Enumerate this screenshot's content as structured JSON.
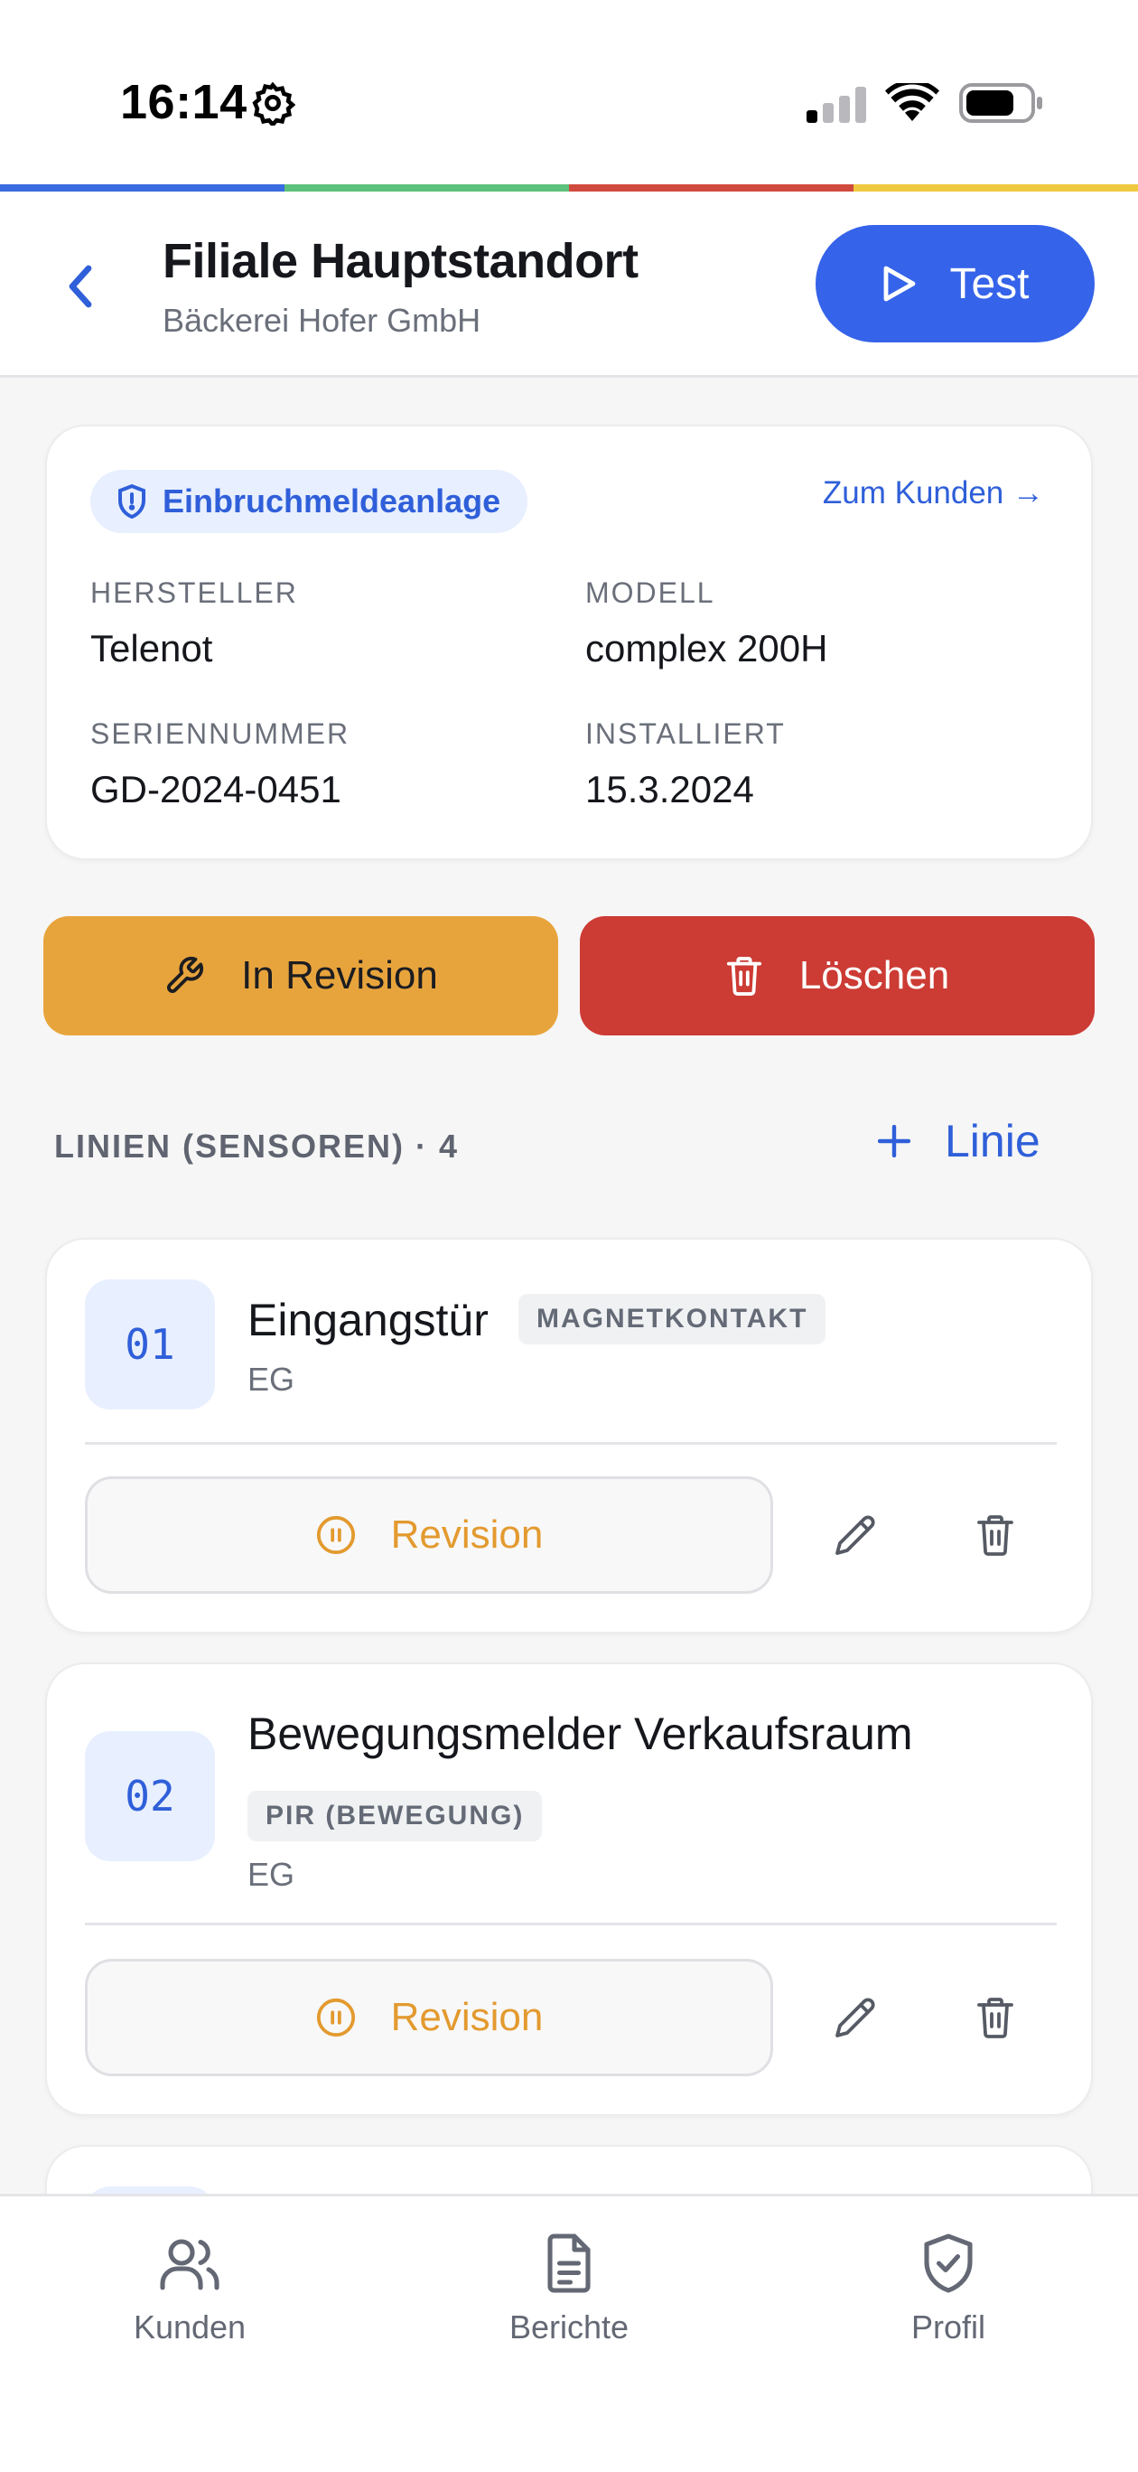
{
  "status_bar": {
    "time": "16:14",
    "icons": [
      "gear-icon",
      "signal-icon",
      "wifi-icon",
      "battery-icon"
    ]
  },
  "stripe_colors": [
    "#3a6be0",
    "#5cc17a",
    "#d14a3e",
    "#efc93f"
  ],
  "header": {
    "title": "Filiale Hauptstandort",
    "subtitle": "Bäckerei Hofer GmbH",
    "test_label": "Test"
  },
  "system": {
    "type": "Einbruchmeldeanlage",
    "to_customer": "Zum Kunden →",
    "fields": [
      {
        "label": "HERSTELLER",
        "value": "Telenot"
      },
      {
        "label": "MODELL",
        "value": "complex 200H"
      },
      {
        "label": "SERIENNUMMER",
        "value": "GD-2024-0451"
      },
      {
        "label": "INSTALLIERT",
        "value": "15.3.2024"
      }
    ]
  },
  "actions": {
    "revision_label": "In Revision",
    "delete_label": "Löschen"
  },
  "lines_section": {
    "heading": "LINIEN (SENSOREN) · 4",
    "add_label": "Linie"
  },
  "lines": [
    {
      "number": "01",
      "name": "Eingangstür",
      "type": "MAGNETKONTAKT",
      "floor": "EG",
      "status": "Revision"
    },
    {
      "number": "02",
      "name": "Bewegungsmelder Verkaufsraum",
      "type": "PIR (BEWEGUNG)",
      "floor": "EG",
      "status": "Revision"
    }
  ],
  "nav": {
    "items": [
      {
        "label": "Kunden",
        "icon": "users-icon"
      },
      {
        "label": "Berichte",
        "icon": "document-icon"
      },
      {
        "label": "Profil",
        "icon": "shield-check-icon"
      }
    ]
  },
  "colors": {
    "accent": "#3563e9",
    "revision": "#e8a43c",
    "danger": "#cc3b34",
    "revision_text": "#e39a2f"
  }
}
